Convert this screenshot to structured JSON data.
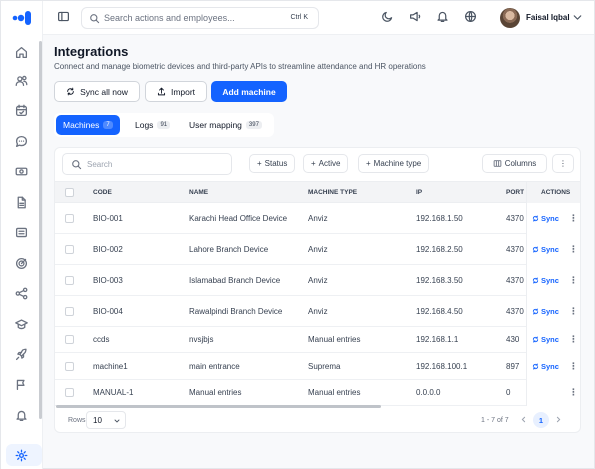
{
  "topbar": {
    "search_placeholder": "Search actions and employees...",
    "search_shortcut": "Ctrl K",
    "user_name": "Faisal Iqbal"
  },
  "sidebar": {
    "items": [
      {
        "icon": "home-icon"
      },
      {
        "icon": "users-icon"
      },
      {
        "icon": "calendar-icon"
      },
      {
        "icon": "chat-icon"
      },
      {
        "icon": "money-icon"
      },
      {
        "icon": "document-icon"
      },
      {
        "icon": "list-icon"
      },
      {
        "icon": "target-icon"
      },
      {
        "icon": "workflow-icon"
      },
      {
        "icon": "graduation-icon"
      },
      {
        "icon": "rocket-icon"
      },
      {
        "icon": "flag-icon"
      },
      {
        "icon": "bell-icon"
      },
      {
        "icon": "settings-icon"
      }
    ],
    "active": "settings-icon"
  },
  "page": {
    "title": "Integrations",
    "subtitle": "Connect and manage biometric devices and third-party APIs to streamline attendance and HR operations"
  },
  "actions": {
    "sync_all": "Sync all now",
    "import": "Import",
    "add_machine": "Add machine"
  },
  "tabs": [
    {
      "label": "Machines",
      "count": "7"
    },
    {
      "label": "Logs",
      "count": "91"
    },
    {
      "label": "User mapping",
      "count": "397"
    }
  ],
  "table": {
    "search_placeholder": "Search",
    "filters": [
      "Status",
      "Active",
      "Machine type"
    ],
    "columns_button": "Columns",
    "headers": [
      "CODE",
      "NAME",
      "MACHINE TYPE",
      "IP",
      "PORT",
      "ACTIONS"
    ],
    "sync_label": "Sync",
    "rows": [
      {
        "code": "BIO-001",
        "name": "Karachi Head Office Device",
        "type": "Anviz",
        "ip": "192.168.1.50",
        "port": "4370",
        "sync": true
      },
      {
        "code": "BIO-002",
        "name": "Lahore Branch Device",
        "type": "Anviz",
        "ip": "192.168.2.50",
        "port": "4370",
        "sync": true
      },
      {
        "code": "BIO-003",
        "name": "Islamabad Branch Device",
        "type": "Anviz",
        "ip": "192.168.3.50",
        "port": "4370",
        "sync": true
      },
      {
        "code": "BIO-004",
        "name": "Rawalpindi Branch Device",
        "type": "Anviz",
        "ip": "192.168.4.50",
        "port": "4370",
        "sync": true
      },
      {
        "code": "ccds",
        "name": "nvsjbjs",
        "type": "Manual entries",
        "ip": "192.168.1.1",
        "port": "430",
        "sync": true
      },
      {
        "code": "machine1",
        "name": "main entrance",
        "type": "Suprema",
        "ip": "192.168.100.1",
        "port": "897",
        "sync": true
      },
      {
        "code": "MANUAL-1",
        "name": "Manual entries",
        "type": "Manual entries",
        "ip": "0.0.0.0",
        "port": "0",
        "sync": false
      }
    ]
  },
  "footer": {
    "rows_label": "Rows",
    "rows_value": "10",
    "range": "1 - 7 of 7",
    "page": "1"
  },
  "colors": {
    "accent": "#1463ff",
    "background": "#f8f9fb"
  }
}
